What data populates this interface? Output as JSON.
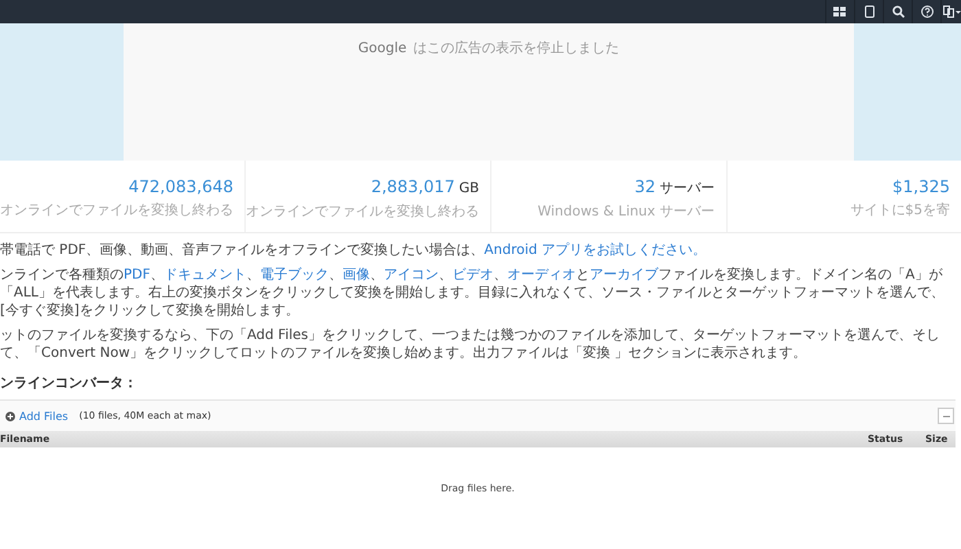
{
  "ad_notice": {
    "brand": "Google",
    "message": "はこの広告の表示を停止しました"
  },
  "stats": [
    {
      "value": "472,083,648",
      "caption": "オンラインでファイルを変換し終わる"
    },
    {
      "value": "2,883,017",
      "unit": "GB",
      "caption": "オンラインでファイルを変換し終わる"
    },
    {
      "value": "32",
      "unit": "サーバー",
      "caption": "Windows & Linux サーバー"
    },
    {
      "value": "$1,325",
      "caption": "サイトに$5を寄"
    }
  ],
  "paragraphs": [
    {
      "parts": [
        {
          "text": "帯電話で PDF、画像、動画、音声ファイルをオフラインで変換したい場合は、",
          "link": false
        },
        {
          "text": "Android アプリをお試しください。",
          "link": true
        }
      ]
    },
    {
      "parts": [
        {
          "text": "ンラインで各種類の",
          "link": false
        },
        {
          "text": "PDF",
          "link": true
        },
        {
          "text": "、",
          "link": false
        },
        {
          "text": "ドキュメント",
          "link": true
        },
        {
          "text": "、",
          "link": false
        },
        {
          "text": "電子ブック",
          "link": true
        },
        {
          "text": "、",
          "link": false
        },
        {
          "text": "画像",
          "link": true
        },
        {
          "text": "、",
          "link": false
        },
        {
          "text": "アイコン",
          "link": true
        },
        {
          "text": "、",
          "link": false
        },
        {
          "text": "ビデオ",
          "link": true
        },
        {
          "text": "、",
          "link": false
        },
        {
          "text": "オーディオ",
          "link": true
        },
        {
          "text": "と",
          "link": false
        },
        {
          "text": "アーカイブ",
          "link": true
        },
        {
          "text": "ファイルを変換します。ドメイン名の「A」が「ALL」を代表します。右上の変換ボタンをクリックして変換を開始します。目録に入れなくて、ソース・ファイルとターゲットフォーマットを選んで、[今すぐ変換]をクリックして変換を開始します。",
          "link": false
        }
      ]
    },
    {
      "parts": [
        {
          "text": "ットのファイルを変換するなら、下の「Add Files」をクリックして、一つまたは幾つかのファイルを添加して、ターゲットフォーマットを選んで、そして、「Convert Now」をクリックしてロットのファイルを変換し始めます。出力ファイルは「変換 」セクションに表示されます。",
          "link": false
        }
      ]
    }
  ],
  "converter": {
    "heading": "ンラインコンバータ：",
    "add_files_button": "Add Files",
    "limit_note": "(10 files, 40M each at max)",
    "columns": [
      "Filename",
      "Status",
      "Size"
    ],
    "empty_message": "Drag files here."
  }
}
